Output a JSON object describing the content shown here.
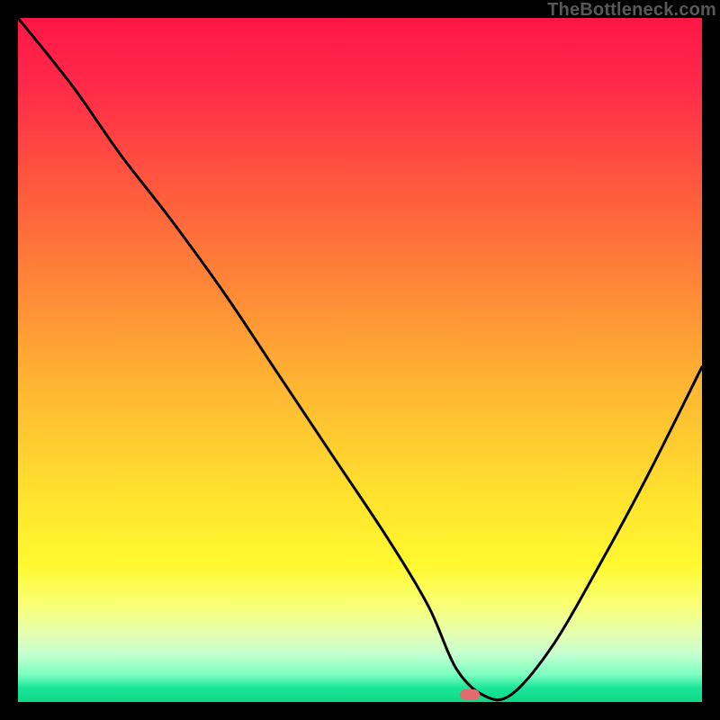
{
  "watermark": "TheBottleneck.com",
  "marker": {
    "x_pct": 66,
    "y_pct": 99
  },
  "chart_data": {
    "type": "line",
    "title": "",
    "xlabel": "",
    "ylabel": "",
    "xlim": [
      0,
      100
    ],
    "ylim": [
      0,
      100
    ],
    "grid": false,
    "series": [
      {
        "name": "bottleneck-curve",
        "x": [
          0,
          8,
          15,
          22,
          30,
          38,
          46,
          54,
          60,
          64,
          68,
          72,
          78,
          85,
          92,
          100
        ],
        "values": [
          100,
          90,
          80,
          71,
          60,
          48,
          36,
          24,
          14,
          5,
          1,
          1,
          8,
          20,
          33,
          49
        ]
      }
    ],
    "annotations": [
      {
        "type": "marker",
        "x": 66,
        "y": 1,
        "shape": "pill",
        "color": "#e56a6e"
      }
    ],
    "background_gradient": {
      "direction": "vertical",
      "stops": [
        {
          "pos": 0.0,
          "color": "#ff1746"
        },
        {
          "pos": 0.5,
          "color": "#ffb030"
        },
        {
          "pos": 0.8,
          "color": "#fff92f"
        },
        {
          "pos": 1.0,
          "color": "#0fd888"
        }
      ]
    }
  }
}
